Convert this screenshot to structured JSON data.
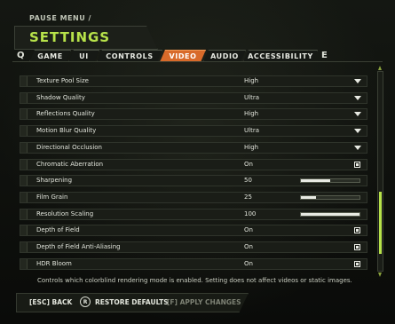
{
  "header": {
    "breadcrumb": "PAUSE MENU /",
    "title": "SETTINGS"
  },
  "tabs": {
    "prev_key": "Q",
    "next_key": "E",
    "items": [
      {
        "label": "GAME"
      },
      {
        "label": "UI"
      },
      {
        "label": "CONTROLS"
      },
      {
        "label": "VIDEO",
        "active": true
      },
      {
        "label": "AUDIO"
      },
      {
        "label": "ACCESSIBILITY"
      }
    ]
  },
  "settings": [
    {
      "label": "Texture Pool Size",
      "value": "High",
      "control": "dropdown"
    },
    {
      "label": "Shadow Quality",
      "value": "Ultra",
      "control": "dropdown"
    },
    {
      "label": "Reflections Quality",
      "value": "High",
      "control": "dropdown"
    },
    {
      "label": "Motion Blur Quality",
      "value": "Ultra",
      "control": "dropdown"
    },
    {
      "label": "Directional Occlusion",
      "value": "High",
      "control": "dropdown"
    },
    {
      "label": "Chromatic Aberration",
      "value": "On",
      "control": "checkbox"
    },
    {
      "label": "Sharpening",
      "value": "50",
      "control": "slider",
      "fraction": 0.5
    },
    {
      "label": "Film Grain",
      "value": "25",
      "control": "slider",
      "fraction": 0.25
    },
    {
      "label": "Resolution Scaling",
      "value": "100",
      "control": "slider",
      "fraction": 1.0
    },
    {
      "label": "Depth of Field",
      "value": "On",
      "control": "checkbox"
    },
    {
      "label": "Depth of Field Anti-Aliasing",
      "value": "On",
      "control": "checkbox"
    },
    {
      "label": "HDR Bloom",
      "value": "On",
      "control": "checkbox"
    }
  ],
  "description": "Controls which colorblind rendering mode is enabled. Setting does not affect videos or static images.",
  "footer": {
    "back": "[ESC] BACK",
    "restore_key": "R",
    "restore": "RESTORE DEFAULTS",
    "apply": "[F] APPLY CHANGES"
  },
  "colors": {
    "accent": "#b7e24a",
    "active_tab": "#d86a2a"
  }
}
